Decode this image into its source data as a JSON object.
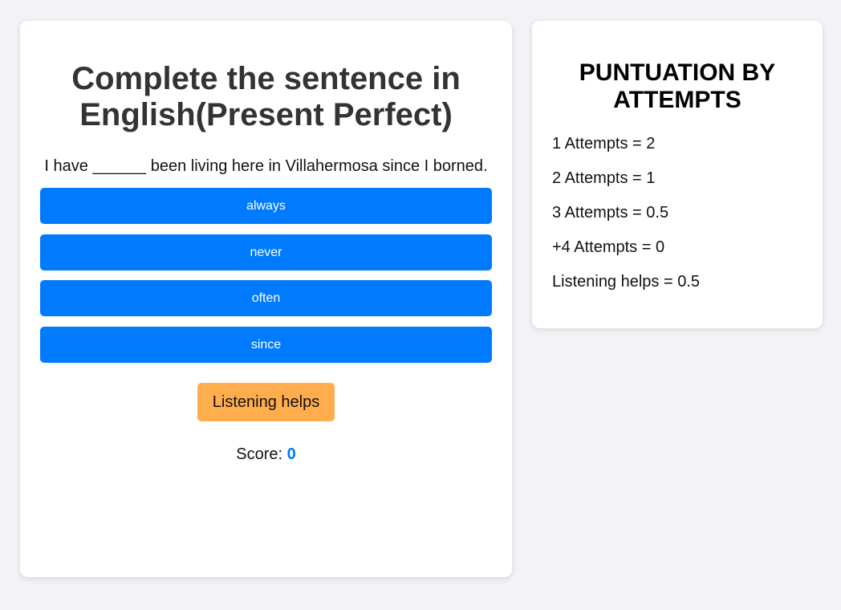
{
  "quiz": {
    "title": "Complete the sentence in English(Present Perfect)",
    "sentence": "I have ______ been living here in Villahermosa since I borned.",
    "options": [
      {
        "label": "always"
      },
      {
        "label": "never"
      },
      {
        "label": "often"
      },
      {
        "label": "since"
      }
    ],
    "listen_label": "Listening helps",
    "score_label": "Score:",
    "score_value": "0"
  },
  "scoring": {
    "title": "PUNTUATION BY ATTEMPTS",
    "rules": [
      {
        "text": "1 Attempts = 2"
      },
      {
        "text": "2 Attempts = 1"
      },
      {
        "text": "3 Attempts = 0.5"
      },
      {
        "text": "+4 Attempts = 0"
      },
      {
        "text": "Listening helps = 0.5"
      }
    ]
  },
  "colors": {
    "background": "#f3f3f7",
    "option_button": "#007bff",
    "listen_button": "#ffad4d",
    "score_value": "#007bff"
  }
}
